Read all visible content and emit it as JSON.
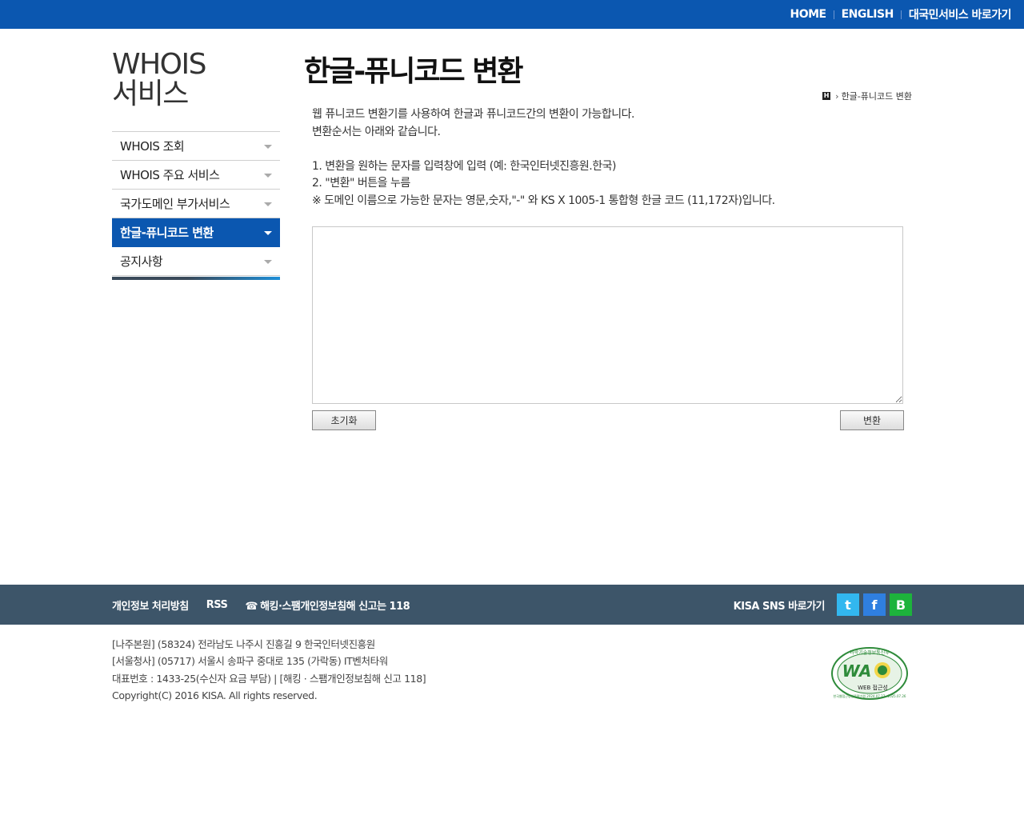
{
  "top_nav": {
    "home": "HOME",
    "english": "ENGLISH",
    "gov_service": "대국민서비스 바로가기"
  },
  "brand": {
    "line1": "WHOIS",
    "line2": "서비스"
  },
  "sidebar": {
    "items": [
      {
        "label": "WHOIS 조회"
      },
      {
        "label": "WHOIS 주요 서비스"
      },
      {
        "label": "국가도메인 부가서비스"
      },
      {
        "label": "한글-퓨니코드 변환",
        "active": true
      },
      {
        "label": "공지사항"
      }
    ]
  },
  "main": {
    "title": "한글-퓨니코드 변환",
    "breadcrumb": {
      "home_icon": "H",
      "current": "한글-퓨니코드 변환"
    },
    "desc": {
      "line1": "웹 퓨니코드 변환기를 사용하여 한글과 퓨니코드간의 변환이 가능합니다.",
      "line2": "변환순서는 아래와 같습니다.",
      "step1": "1. 변환을 원하는 문자를 입력창에 입력 (예: 한국인터넷진흥원.한국)",
      "step2": "2. \"변환\" 버튼을 누름",
      "note": "※ 도메인 이름으로 가능한 문자는 영문,숫자,\"-\" 와 KS X 1005-1 통합형 한글 코드 (11,172자)입니다."
    },
    "textarea_value": "",
    "reset_label": "초기화",
    "convert_label": "변환"
  },
  "footer": {
    "privacy": "개인정보 처리방침",
    "rss": "RSS",
    "report": "해킹·스팸개인정보침해 신고는 118",
    "sns_label": "KISA SNS 바로가기",
    "sns": {
      "twitter": "t",
      "facebook": "f",
      "blog": "B"
    },
    "info": {
      "line1": "[나주본원]  (58324) 전라남도 나주시 진흥길 9 한국인터넷진흥원",
      "line2": "[서울청사]  (05717) 서울시 송파구 중대로 135 (가락동) IT벤처타워",
      "line3": "대표번호 : 1433-25(수신자 요금 부담)  |  [해킹 · 스팸개인정보침해 신고 118]",
      "line4": "Copyright(C) 2016 KISA. All rights reserved."
    },
    "wa_mark": {
      "top_text": "과학기술정보통신부",
      "logo_text": "WA",
      "sub_text": "WEB 접근성",
      "bottom_text": "한국웹접근성인증평가원 2024.07.27~2025.07.26"
    }
  },
  "colors": {
    "brand_blue": "#0b57b0",
    "footer_bar": "#3d5569",
    "twitter": "#32b7ef",
    "facebook": "#2f7fe0",
    "blog": "#1db33c"
  }
}
